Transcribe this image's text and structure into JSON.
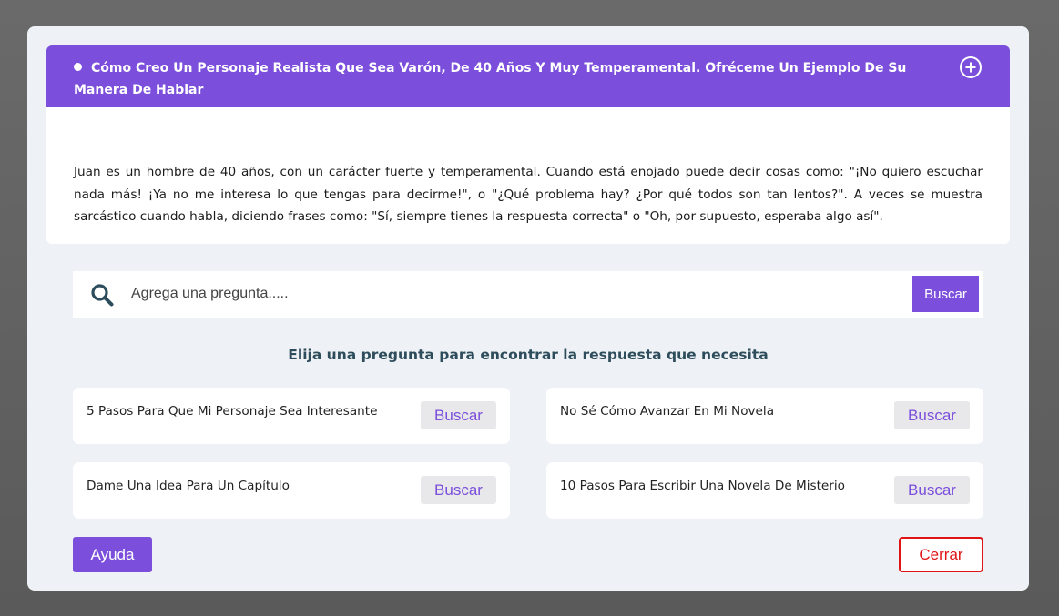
{
  "answer": {
    "title": "Cómo Creo Un Personaje Realista Que Sea Varón, De 40 Años Y Muy Temperamental. Ofréceme Un Ejemplo De Su Manera De Hablar",
    "expand_icon": "plus-circle-icon",
    "body": "Juan es un hombre de 40 años, con un carácter fuerte y temperamental. Cuando está enojado puede decir cosas como: \"¡No quiero escuchar nada más! ¡Ya no me interesa lo que tengas para decirme!\", o \"¿Qué problema hay? ¿Por qué todos son tan lentos?\". A veces se muestra sarcástico cuando habla, diciendo frases como: \"Sí, siempre tienes la respuesta correcta\" o \"Oh, por supuesto, esperaba algo así\"."
  },
  "search": {
    "icon": "search-icon",
    "placeholder": "Agrega una pregunta.....",
    "value": "",
    "button_label": "Buscar"
  },
  "prompt_heading": "Elija una pregunta para encontrar la respuesta que necesita",
  "suggestions": [
    {
      "text": "5 Pasos Para Que Mi Personaje Sea Interesante",
      "button_label": "Buscar"
    },
    {
      "text": "No Sé Cómo Avanzar En Mi Novela",
      "button_label": "Buscar"
    },
    {
      "text": "Dame Una Idea Para Un Capítulo",
      "button_label": "Buscar"
    },
    {
      "text": "10 Pasos Para Escribir Una Novela De Misterio",
      "button_label": "Buscar"
    }
  ],
  "footer": {
    "help_label": "Ayuda",
    "close_label": "Cerrar"
  },
  "colors": {
    "accent": "#7b4fdb",
    "modal_bg": "#eef1f5",
    "heading": "#2e4d5c",
    "close": "#e01414"
  }
}
